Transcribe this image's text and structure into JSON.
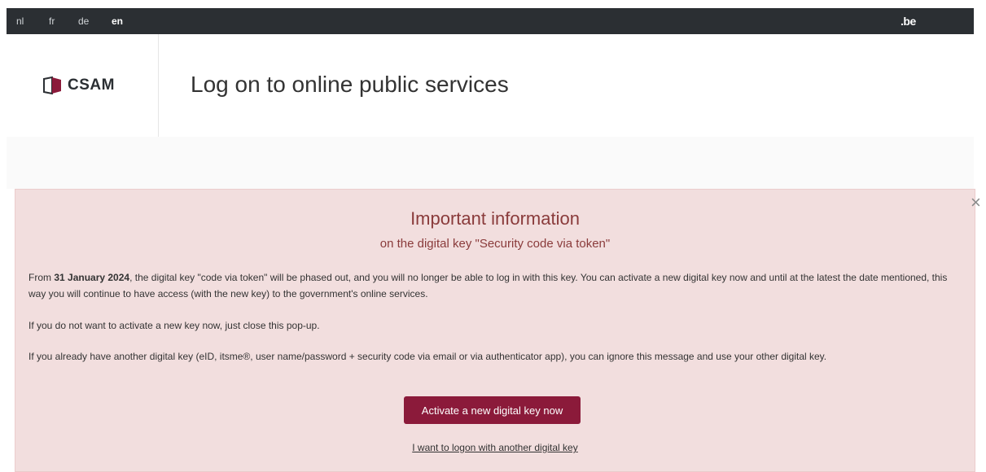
{
  "topbar": {
    "languages": [
      "nl",
      "fr",
      "de",
      "en"
    ],
    "active_language": "en",
    "domain": ".be"
  },
  "header": {
    "logo_text": "CSAM",
    "title": "Log on to online public services"
  },
  "banner": {
    "title": "Important information",
    "subtitle": "on the digital key \"Security code via token\"",
    "para1_prefix": "From ",
    "para1_date": "31 January 2024",
    "para1_rest": ", the digital key \"code via token\" will be phased out, and you will no longer be able to log in with this key. You can activate a new digital key now and until at the latest the date mentioned, this way you will continue to have access (with the new key) to the government's online services.",
    "para2": "If you do not want to activate a new key now, just close this pop-up.",
    "para3": "If you already have another digital key (eID, itsme®, user name/password + security code via email or via authenticator app), you can ignore this message and use your other digital key.",
    "activate_button": "Activate a new digital key now",
    "alt_link": "I want to logon with another digital key",
    "close_symbol": "×"
  },
  "colors": {
    "topbar": "#2b2f33",
    "banner_bg": "#f2dede",
    "banner_text": "#8a3b3b",
    "button": "#8b1a3a"
  }
}
